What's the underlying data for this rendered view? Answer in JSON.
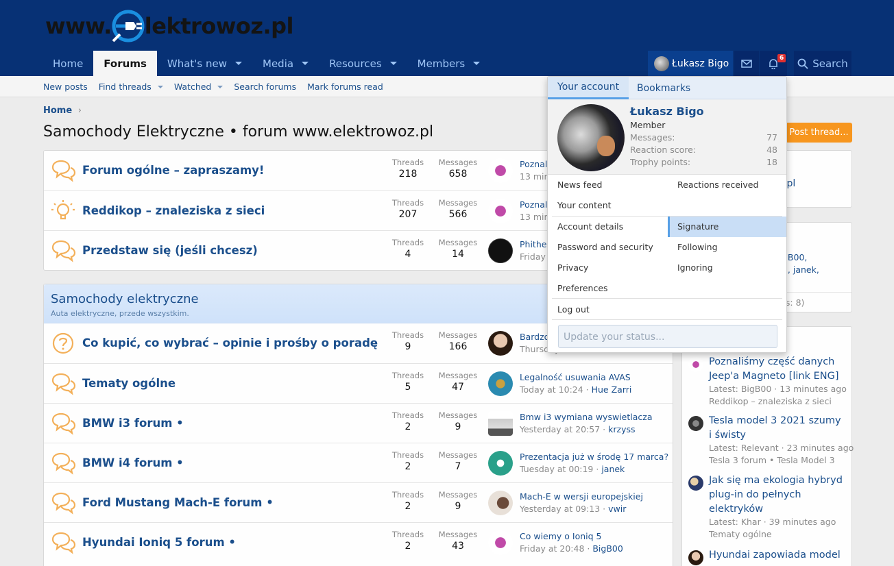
{
  "logo": {
    "prefix": "www.",
    "suffix": "lektrowoz.pl"
  },
  "nav": {
    "tabs": [
      {
        "label": "Home",
        "active": false,
        "caret": false
      },
      {
        "label": "Forums",
        "active": true,
        "caret": false
      },
      {
        "label": "What's new",
        "active": false,
        "caret": true
      },
      {
        "label": "Media",
        "active": false,
        "caret": true
      },
      {
        "label": "Resources",
        "active": false,
        "caret": true
      },
      {
        "label": "Members",
        "active": false,
        "caret": true
      }
    ],
    "user": "Łukasz Bigo",
    "alerts_badge": "6",
    "search": "Search"
  },
  "subnav": [
    {
      "label": "New posts",
      "caret": false
    },
    {
      "label": "Find threads",
      "caret": true
    },
    {
      "label": "Watched",
      "caret": true
    },
    {
      "label": "Search forums",
      "caret": false
    },
    {
      "label": "Mark forums read",
      "caret": false
    }
  ],
  "breadcrumb": "Home",
  "page_title": "Samochody Elektryczne • forum www.elektrowoz.pl",
  "post_thread": "Post thread...",
  "labels": {
    "threads": "Threads",
    "messages": "Messages"
  },
  "block1": [
    {
      "title": "Forum ogólne – zapraszamy!",
      "threads": "218",
      "messages": "658",
      "last_title": "Poznali",
      "last_meta": "13 min"
    },
    {
      "title": "Reddikop – znaleziska z sieci",
      "threads": "207",
      "messages": "566",
      "last_title": "Poznali",
      "last_meta": "13 min"
    },
    {
      "title": "Przedstaw się (jeśli chcesz)",
      "threads": "4",
      "messages": "14",
      "last_title": "Phither",
      "last_meta": "Friday a"
    }
  ],
  "category": {
    "title": "Samochody elektryczne",
    "desc": "Auta elektryczne, przede wszystkim."
  },
  "block2": [
    {
      "title": "Co kupić, co wybrać – opinie i prośby o poradę",
      "threads": "9",
      "messages": "166",
      "last_title": "Bardzo",
      "last_meta": "Thursday",
      "last_user": ""
    },
    {
      "title": "Tematy ogólne",
      "threads": "5",
      "messages": "47",
      "last_title": "Legalność usuwania AVAS",
      "last_meta": "Today at 10:24 · ",
      "last_user": "Hue Zarri"
    },
    {
      "title": "BMW i3 forum •",
      "threads": "2",
      "messages": "9",
      "last_title": "Bmw i3 wymiana wyswietlacza",
      "last_meta": "Yesterday at 20:57 · ",
      "last_user": "krzyss"
    },
    {
      "title": "BMW i4 forum •",
      "threads": "2",
      "messages": "7",
      "last_title": "Prezentacja już w środę 17 marca?",
      "last_meta": "Tuesday at 00:19 · ",
      "last_user": "janek"
    },
    {
      "title": "Ford Mustang Mach-E forum •",
      "threads": "2",
      "messages": "9",
      "last_title": "Mach-E w wersji europejskiej",
      "last_meta": "Yesterday at 09:13 · ",
      "last_user": "vwir"
    },
    {
      "title": "Hyundai Ioniq 5 forum •",
      "threads": "2",
      "messages": "43",
      "last_title": "Co wiemy o Ioniq 5",
      "last_meta": "Friday at 20:48 · ",
      "last_user": "BigB00"
    }
  ],
  "sidebar": {
    "frag1": ".pl",
    "frag2": "gB00,",
    "frag3": "q, janek,",
    "frag4": "ts: 8)",
    "threads": [
      {
        "title": "Poznaliśmy część danych Jeep'a Magneto [link ENG]",
        "latest": "Latest: BigB00 · 13 minutes ago",
        "forum": "Reddikop – znaleziska z sieci"
      },
      {
        "title": "Tesla model 3 2021 szumy i świsty",
        "latest": "Latest: Relevant · 23 minutes ago",
        "forum": "Tesla 3 forum • Tesla Model 3"
      },
      {
        "title": "Jak się ma ekologia hybryd plug-in do pełnych elektryków",
        "latest": "Latest: Khar · 39 minutes ago",
        "forum": "Tematy ogólne"
      },
      {
        "title": "Hyundai zapowiada model",
        "latest": "",
        "forum": ""
      }
    ]
  },
  "account_menu": {
    "tab_account": "Your account",
    "tab_bookmarks": "Bookmarks",
    "name": "Łukasz Bigo",
    "role": "Member",
    "stats": [
      {
        "label": "Messages:",
        "value": "77"
      },
      {
        "label": "Reaction score:",
        "value": "48"
      },
      {
        "label": "Trophy points:",
        "value": "18"
      }
    ],
    "links": {
      "news_feed": "News feed",
      "reactions": "Reactions received",
      "your_content": "Your content",
      "account_details": "Account details",
      "signature": "Signature",
      "password": "Password and security",
      "following": "Following",
      "privacy": "Privacy",
      "ignoring": "Ignoring",
      "preferences": "Preferences",
      "logout": "Log out"
    },
    "status_placeholder": "Update your status..."
  },
  "colors": {
    "header": "#073175",
    "link": "#1b4f8c",
    "accent": "#f7961e",
    "badge": "#e03030"
  }
}
